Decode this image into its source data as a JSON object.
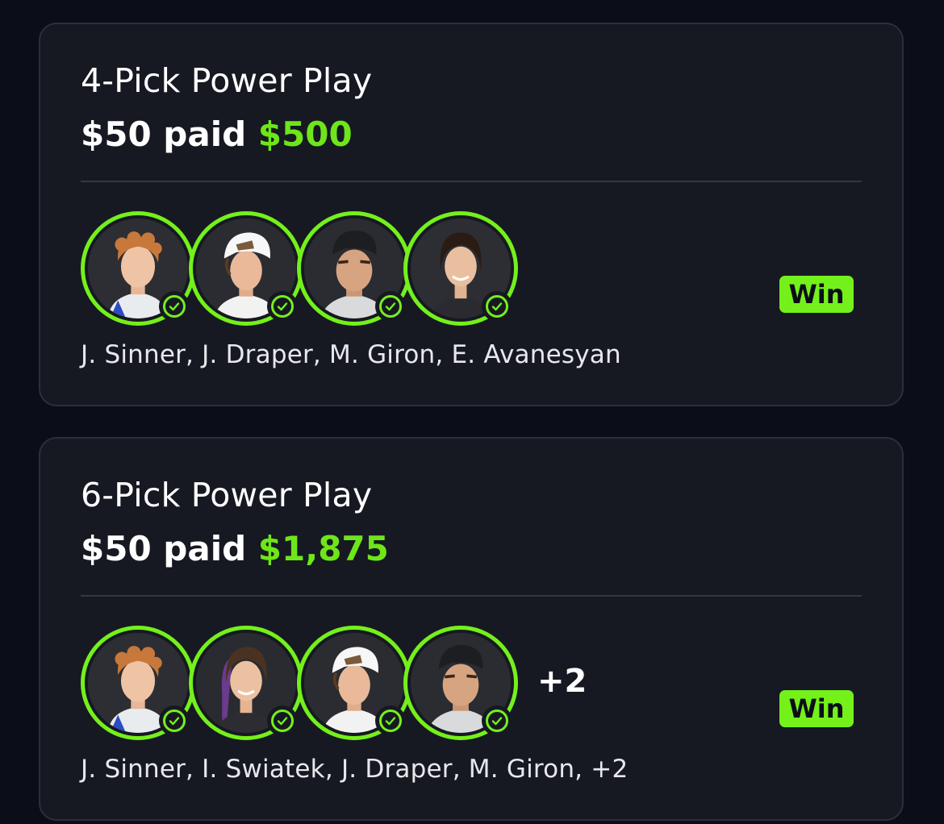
{
  "colors": {
    "background": "#0b0d18",
    "card": "#161922",
    "accent_green": "#74f01b",
    "payout_green": "#6ee619"
  },
  "entries": [
    {
      "title": "4-Pick Power Play",
      "paid_text": "$50 paid",
      "payout": "$500",
      "status": "Win",
      "players_text": "J. Sinner, J. Draper, M. Giron, E. Avanesyan",
      "avatars": [
        {
          "icon": "player-photo-j-sinner",
          "checked": true
        },
        {
          "icon": "player-photo-j-draper",
          "checked": true
        },
        {
          "icon": "player-photo-m-giron",
          "checked": true
        },
        {
          "icon": "player-photo-e-avanesyan",
          "checked": true
        }
      ],
      "more_count": ""
    },
    {
      "title": "6-Pick Power Play",
      "paid_text": "$50 paid",
      "payout": "$1,875",
      "status": "Win",
      "players_text": "J. Sinner, I. Swiatek, J. Draper, M. Giron, +2",
      "avatars": [
        {
          "icon": "player-photo-j-sinner",
          "checked": true
        },
        {
          "icon": "player-photo-i-swiatek",
          "checked": true
        },
        {
          "icon": "player-photo-j-draper",
          "checked": true
        },
        {
          "icon": "player-photo-m-giron",
          "checked": true
        }
      ],
      "more_count": "+2"
    }
  ]
}
